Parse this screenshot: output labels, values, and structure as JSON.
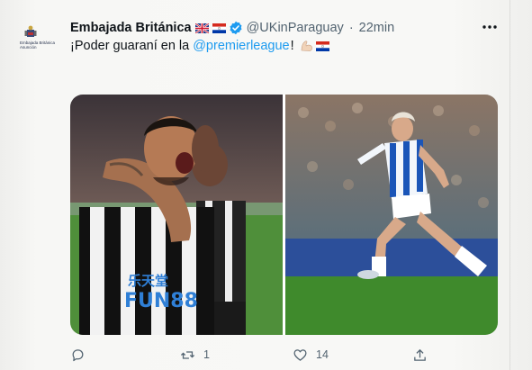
{
  "tweet": {
    "author_name": "Embajada Británica",
    "handle": "@UKinParaguay",
    "separator": "·",
    "time": "22min",
    "text_start": "¡Poder guaraní en la",
    "mention": "@premierleague",
    "text_end": "!",
    "avatar_caption": "Embajada Británica Asunción",
    "flags": [
      "uk-flag",
      "paraguay-flag"
    ]
  },
  "actions": {
    "reply_count": "",
    "retweet_count": "1",
    "like_count": "14"
  },
  "media": {
    "photos": [
      "newcastle-player-celebrating",
      "brighton-player-running"
    ],
    "left_shirt_sponsor": "FUN88",
    "left_shirt_sponsor_cn": "乐天堂"
  },
  "colors": {
    "link": "#1d9bf0",
    "verified": "#1d9bf0",
    "muted": "#536471",
    "text": "#0f1419"
  }
}
